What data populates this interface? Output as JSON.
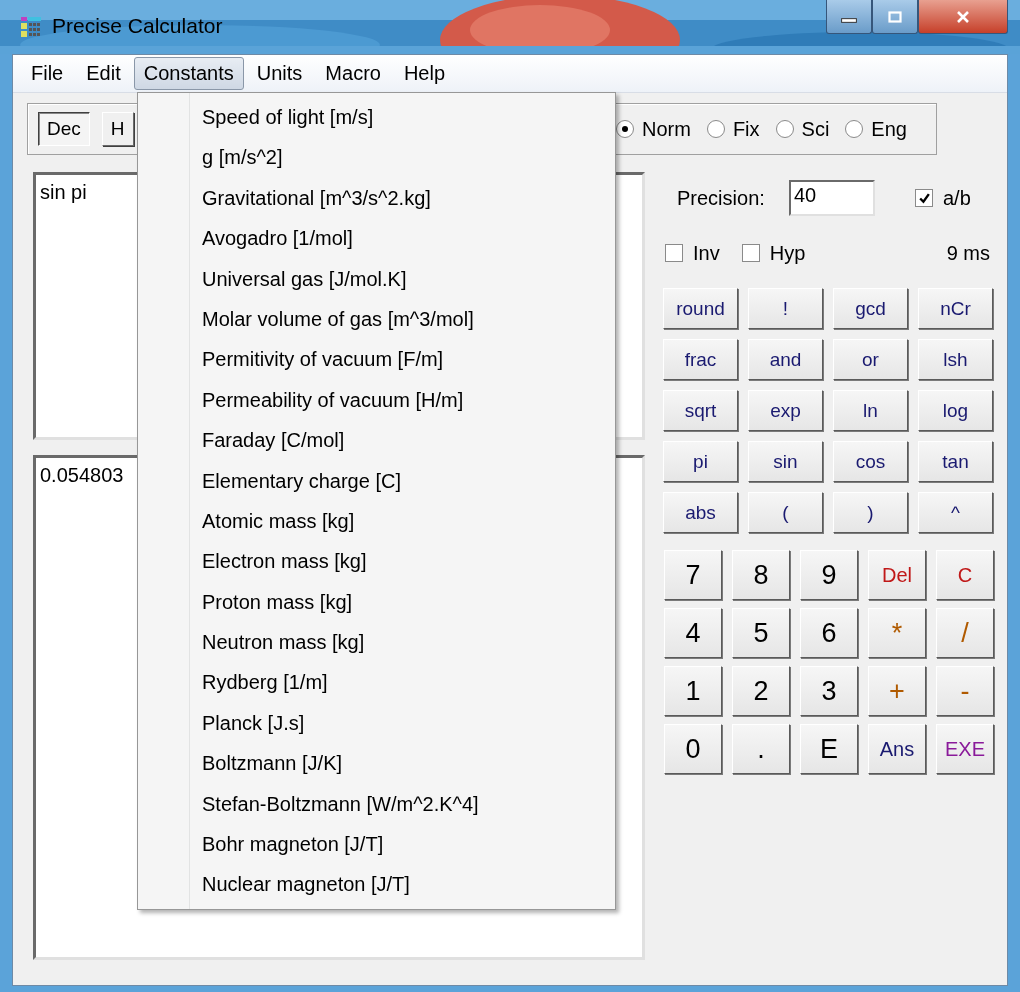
{
  "window": {
    "title": "Precise Calculator"
  },
  "menu_bar": [
    {
      "label": "File",
      "selected": false
    },
    {
      "label": "Edit",
      "selected": false
    },
    {
      "label": "Constants",
      "selected": true
    },
    {
      "label": "Units",
      "selected": false
    },
    {
      "label": "Macro",
      "selected": false
    },
    {
      "label": "Help",
      "selected": false
    }
  ],
  "constants_menu": {
    "items": [
      "Speed of light [m/s]",
      "g [m/s^2]",
      "Gravitational [m^3/s^2.kg]",
      "Avogadro [1/mol]",
      "Universal gas [J/mol.K]",
      "Molar volume of gas [m^3/mol]",
      "Permitivity of vacuum [F/m]",
      "Permeability of vacuum [H/m]",
      "Faraday [C/mol]",
      "Elementary charge [C]",
      "Atomic mass [kg]",
      "Electron mass [kg]",
      "Proton mass [kg]",
      "Neutron mass [kg]",
      "Rydberg [1/m]",
      "Planck [J.s]",
      "Boltzmann [J/K]",
      "Stefan-Boltzmann [W/m^2.K^4]",
      "Bohr magneton [J/T]",
      "Nuclear magneton [J/T]"
    ]
  },
  "base_buttons": [
    {
      "label": "Dec",
      "selected": true
    },
    {
      "label": "H",
      "selected": false
    }
  ],
  "format_options": [
    {
      "label": "Norm",
      "selected": true
    },
    {
      "label": "Fix",
      "selected": false
    },
    {
      "label": "Sci",
      "selected": false
    },
    {
      "label": "Eng",
      "selected": false
    }
  ],
  "input": {
    "value": "sin pi"
  },
  "output": {
    "value": "0.054803"
  },
  "precision": {
    "label": "Precision:",
    "value": "40"
  },
  "fraction": {
    "label": "a/b",
    "checked": true
  },
  "modifiers": [
    {
      "label": "Inv",
      "checked": false
    },
    {
      "label": "Hyp",
      "checked": false
    }
  ],
  "timing": "9 ms",
  "function_keys": [
    "round",
    "!",
    "gcd",
    "nCr",
    "frac",
    "and",
    "or",
    "lsh",
    "sqrt",
    "exp",
    "ln",
    "log",
    "pi",
    "sin",
    "cos",
    "tan",
    "abs",
    "(",
    ")",
    "^"
  ],
  "keypad": [
    {
      "label": "7",
      "kind": "digit"
    },
    {
      "label": "8",
      "kind": "digit"
    },
    {
      "label": "9",
      "kind": "digit"
    },
    {
      "label": "Del",
      "kind": "edit"
    },
    {
      "label": "C",
      "kind": "edit"
    },
    {
      "label": "4",
      "kind": "digit"
    },
    {
      "label": "5",
      "kind": "digit"
    },
    {
      "label": "6",
      "kind": "digit"
    },
    {
      "label": "*",
      "kind": "operator"
    },
    {
      "label": "/",
      "kind": "operator"
    },
    {
      "label": "1",
      "kind": "digit"
    },
    {
      "label": "2",
      "kind": "digit"
    },
    {
      "label": "3",
      "kind": "digit"
    },
    {
      "label": "+",
      "kind": "operator"
    },
    {
      "label": "-",
      "kind": "operator"
    },
    {
      "label": "0",
      "kind": "digit"
    },
    {
      "label": ".",
      "kind": "digit"
    },
    {
      "label": "E",
      "kind": "digit"
    },
    {
      "label": "Ans",
      "kind": "recall"
    },
    {
      "label": "EXE",
      "kind": "execute"
    }
  ]
}
